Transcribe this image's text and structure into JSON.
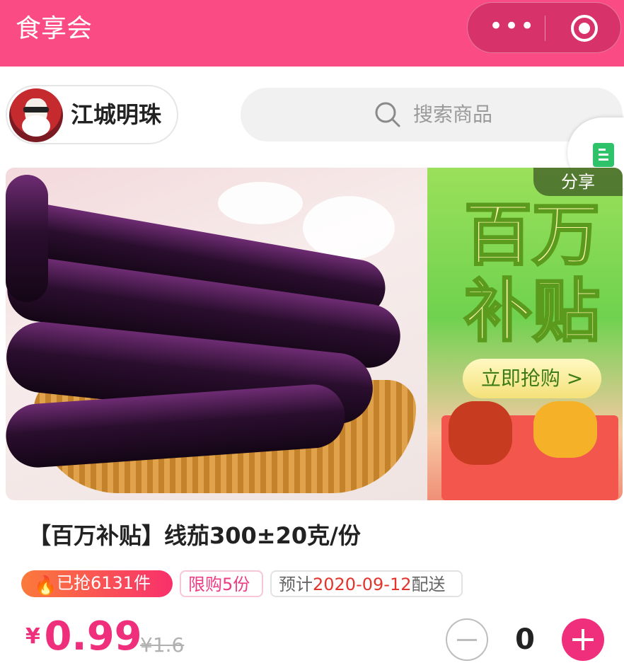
{
  "header": {
    "title": "食享会",
    "more_icon": "more-dots-icon",
    "close_icon": "mini-program-close-icon"
  },
  "shop": {
    "name": "江城明珠"
  },
  "search": {
    "placeholder": "搜索商品",
    "icon": "search-icon"
  },
  "float_button": {
    "icon": "document-icon"
  },
  "banner": {
    "promo_line1": "百万",
    "promo_line2": "补贴",
    "cta": "立即抢购 >",
    "share": "分享"
  },
  "product": {
    "title": "【百万补贴】线茄300±20克/份",
    "sold_tag": "已抢6131件",
    "limit_tag": "限购5份",
    "delivery_prefix": "预计",
    "delivery_date": "2020-09-12",
    "delivery_suffix": "配送",
    "currency": "¥",
    "price": "0.99",
    "original_price": "¥1.6",
    "quantity": "0"
  },
  "colors": {
    "brand_pink": "#fb4b85",
    "price_pink": "#ef2f7c"
  }
}
